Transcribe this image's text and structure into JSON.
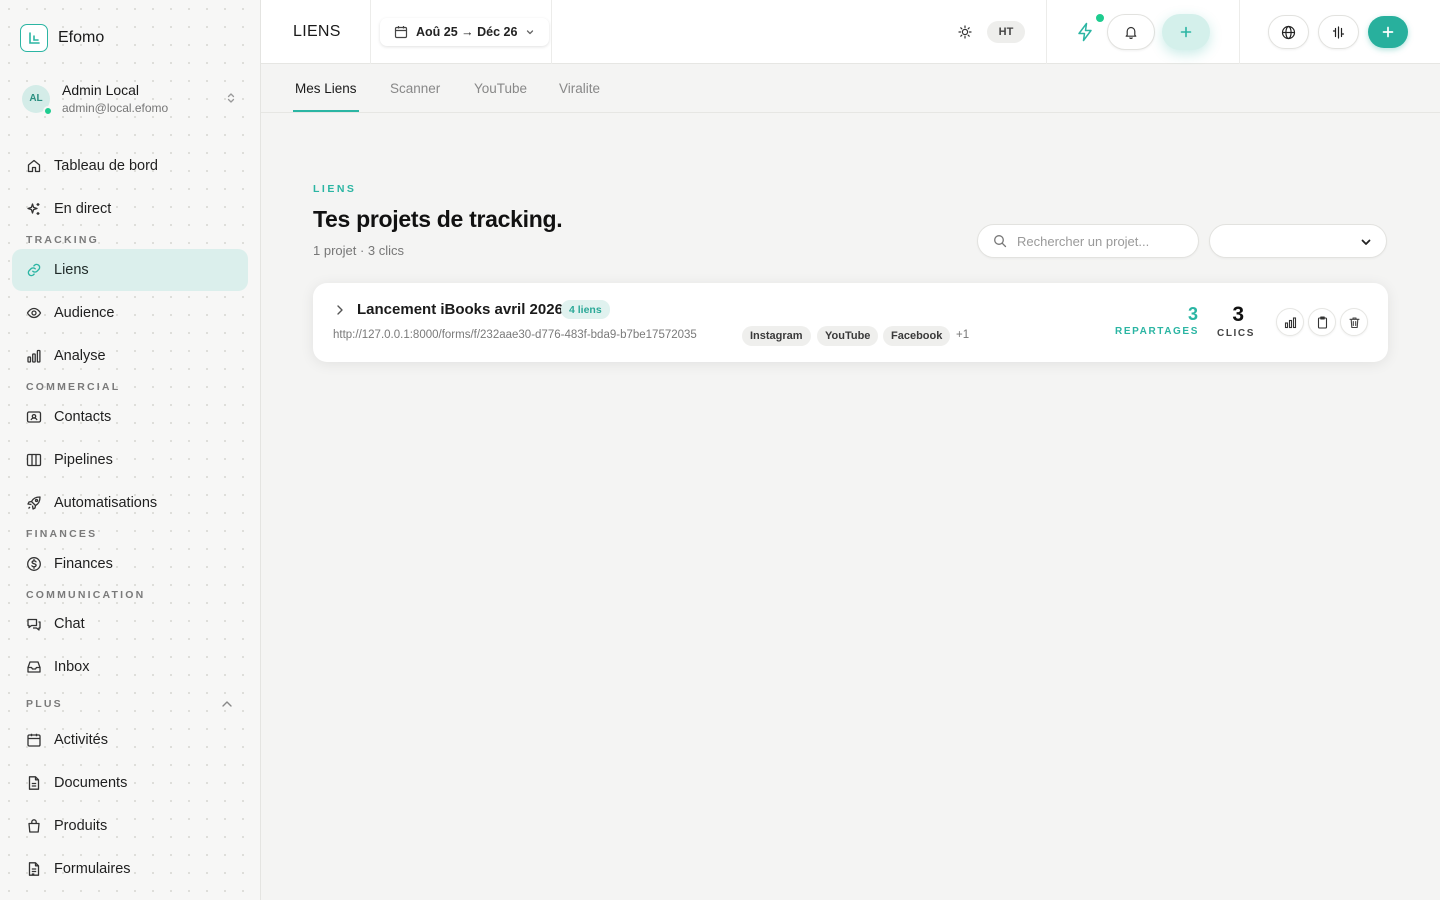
{
  "brand": {
    "name": "Efomo"
  },
  "user": {
    "initials": "AL",
    "name": "Admin Local",
    "email": "admin@local.efomo"
  },
  "sidebar": {
    "top": [
      {
        "label": "Tableau de bord",
        "icon": "home-icon"
      },
      {
        "label": "En direct",
        "icon": "sparkles-icon"
      }
    ],
    "sections": {
      "tracking": "TRACKING",
      "commercial": "COMMERCIAL",
      "finances": "FINANCES",
      "communication": "COMMUNICATION",
      "plus": "PLUS"
    },
    "tracking_items": [
      {
        "label": "Liens",
        "icon": "link-icon",
        "active": true
      },
      {
        "label": "Audience",
        "icon": "eye-icon"
      },
      {
        "label": "Analyse",
        "icon": "bar-chart-icon"
      }
    ],
    "commercial_items": [
      {
        "label": "Contacts",
        "icon": "contact-card-icon"
      },
      {
        "label": "Pipelines",
        "icon": "columns-icon"
      },
      {
        "label": "Automatisations",
        "icon": "rocket-icon"
      }
    ],
    "finances_items": [
      {
        "label": "Finances",
        "icon": "dollar-circle-icon"
      }
    ],
    "communication_items": [
      {
        "label": "Chat",
        "icon": "chat-icon"
      },
      {
        "label": "Inbox",
        "icon": "inbox-icon"
      }
    ],
    "plus_items": [
      {
        "label": "Activités",
        "icon": "calendar-icon"
      },
      {
        "label": "Documents",
        "icon": "document-icon"
      },
      {
        "label": "Produits",
        "icon": "bag-icon"
      },
      {
        "label": "Formulaires",
        "icon": "form-icon"
      }
    ]
  },
  "topbar": {
    "title": "LIENS",
    "date_range": "Aoû 25 → Déc 26",
    "currency_toggle": "HT"
  },
  "tabs": [
    {
      "label": "Mes Liens",
      "active": true
    },
    {
      "label": "Scanner"
    },
    {
      "label": "YouTube"
    },
    {
      "label": "Viralite"
    }
  ],
  "main": {
    "eyebrow": "LIENS",
    "title": "Tes projets de tracking.",
    "subtitle": "1 projet · 3 clics",
    "search": {
      "placeholder": "Rechercher un projet...",
      "value": ""
    },
    "filter_value": ""
  },
  "projects": [
    {
      "title": "Lancement iBooks avril 2026",
      "links_badge": "4 liens",
      "url": "http://127.0.0.1:8000/forms/f/232aae30-d776-483f-bda9-b7be17572035",
      "channels": [
        "Instagram",
        "YouTube",
        "Facebook"
      ],
      "more": "+1",
      "shares": "3",
      "shares_label": "REPARTAGES",
      "clicks": "3",
      "clicks_label": "CLICS"
    }
  ],
  "colors": {
    "accent": "#2bb5a3",
    "accent_soft": "#dbefec",
    "online": "#1ecc8f"
  }
}
